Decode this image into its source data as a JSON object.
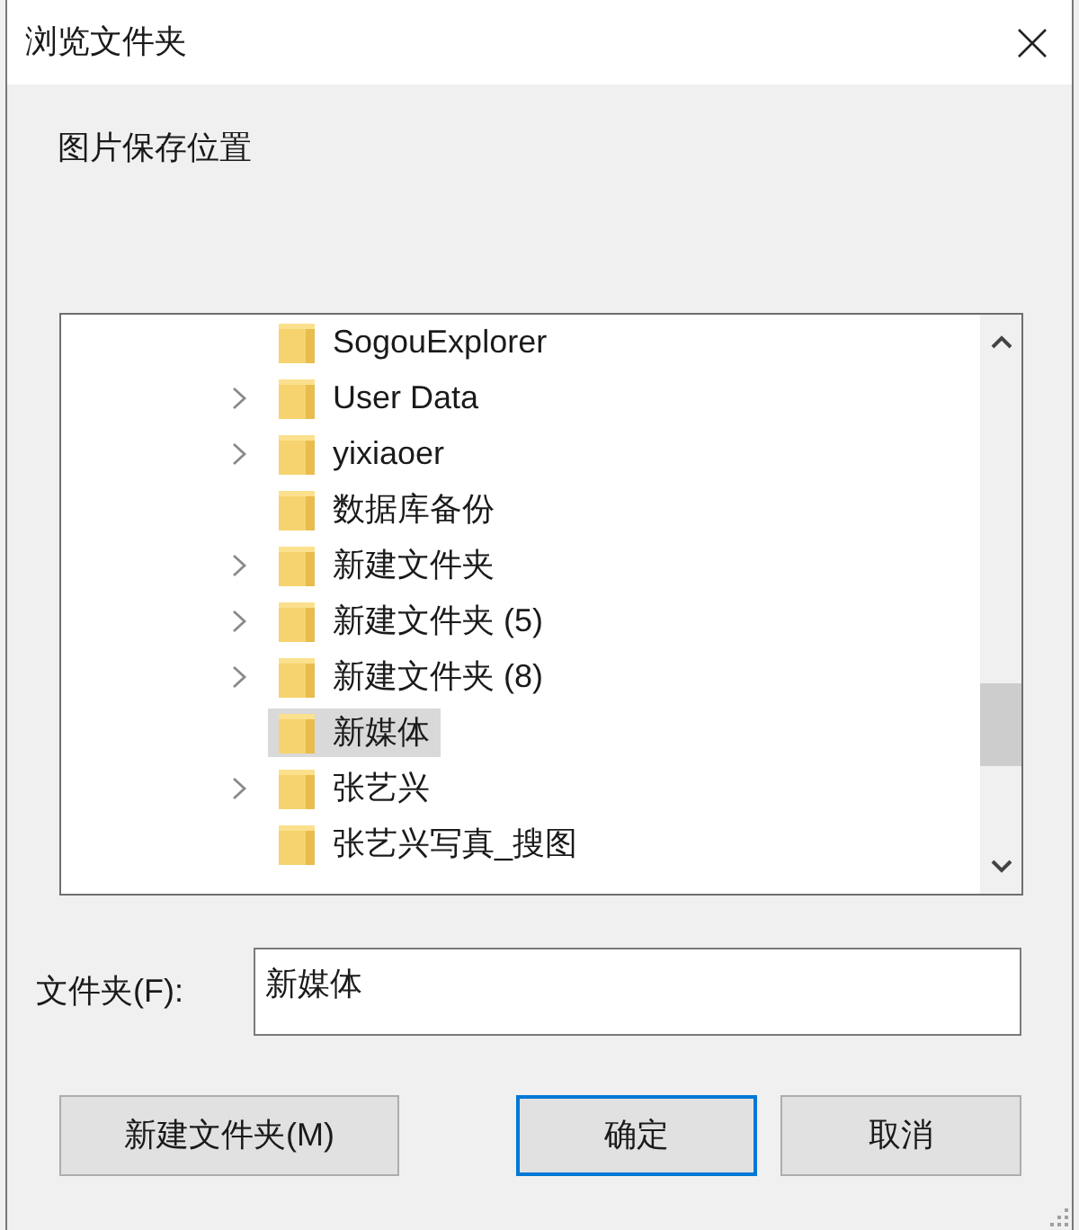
{
  "window": {
    "title": "浏览文件夹"
  },
  "prompt": "图片保存位置",
  "tree": {
    "items": [
      {
        "label": "SogouExplorer",
        "expandable": false,
        "selected": false
      },
      {
        "label": "User Data",
        "expandable": true,
        "selected": false
      },
      {
        "label": "yixiaoer",
        "expandable": true,
        "selected": false
      },
      {
        "label": "数据库备份",
        "expandable": false,
        "selected": false
      },
      {
        "label": "新建文件夹",
        "expandable": true,
        "selected": false
      },
      {
        "label": "新建文件夹 (5)",
        "expandable": true,
        "selected": false
      },
      {
        "label": "新建文件夹 (8)",
        "expandable": true,
        "selected": false
      },
      {
        "label": "新媒体",
        "expandable": false,
        "selected": true
      },
      {
        "label": "张艺兴",
        "expandable": true,
        "selected": false
      },
      {
        "label": "张艺兴写真_搜图",
        "expandable": false,
        "selected": false
      }
    ]
  },
  "folder_field": {
    "label": "文件夹(F):",
    "value": "新媒体"
  },
  "buttons": [
    {
      "label": "新建文件夹(M)",
      "default": false
    },
    {
      "label": "确定",
      "default": true
    },
    {
      "label": "取消",
      "default": false
    }
  ]
}
